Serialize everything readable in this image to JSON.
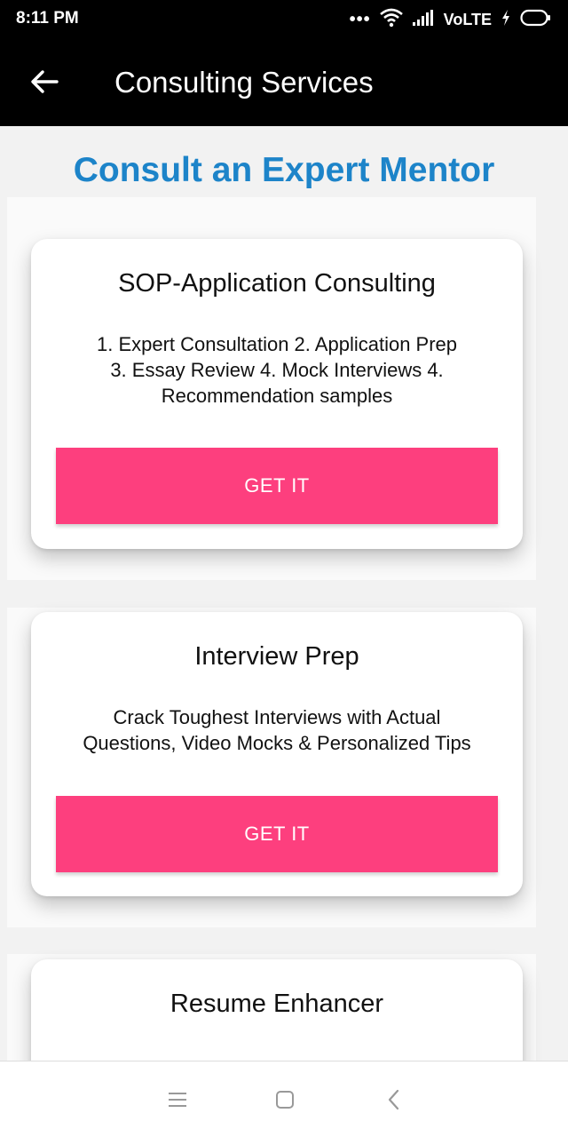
{
  "status_bar": {
    "time": "8:11 PM",
    "dots": "•••",
    "network": "VoLTE",
    "icons": [
      "wifi-icon",
      "signal-icon",
      "charging-icon",
      "battery-icon"
    ]
  },
  "app_bar": {
    "title": "Consulting Services",
    "back_icon": "arrow-left-icon"
  },
  "headline": "Consult an Expert Mentor",
  "cards": [
    {
      "title": "SOP-Application Consulting",
      "description_lines": [
        "1. Expert Consultation 2. Application Prep",
        "3. Essay Review 4. Mock Interviews 4.",
        "Recommendation samples"
      ],
      "button_label": "GET IT"
    },
    {
      "title": "Interview Prep",
      "description_lines": [
        "Crack Toughest Interviews with Actual",
        "Questions, Video Mocks & Personalized Tips"
      ],
      "button_label": "GET IT"
    },
    {
      "title": "Resume Enhancer"
    }
  ],
  "nav_bar": {
    "icons": [
      "menu-icon",
      "home-square-icon",
      "back-chevron-icon"
    ]
  },
  "colors": {
    "headline": "#1d84c9",
    "button": "#fd3f7e",
    "app_bar": "#000000",
    "content_bg": "#f2f2f2"
  }
}
